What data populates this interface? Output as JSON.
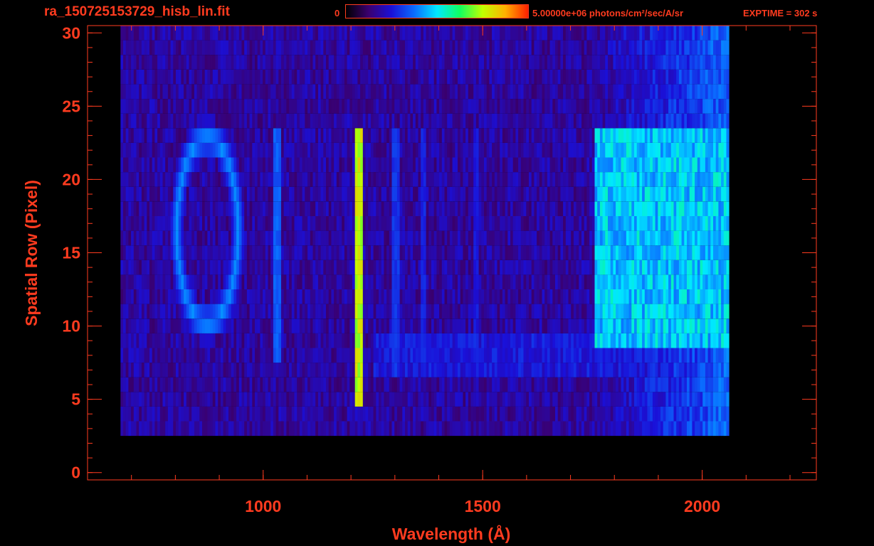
{
  "header": {
    "file_name": "ra_150725153729_hisb_lin.fit",
    "colorbar_min": "0",
    "colorbar_max": "5.00000e+06 photons/cm²/sec/A/sr",
    "exptime": "EXPTIME = 302 s"
  },
  "colors": {
    "axis": "#ff3b1f",
    "background": "#000000",
    "colormap": [
      "#000000",
      "#3a0070",
      "#1a10d8",
      "#0a6cff",
      "#00e8ff",
      "#10ff60",
      "#c0ff00",
      "#ffb000",
      "#ff2000"
    ]
  },
  "chart_data": {
    "type": "heatmap",
    "title": "",
    "xlabel": "Wavelength (Å)",
    "ylabel": "Spatial Row (Pixel)",
    "xlim": [
      600,
      2260
    ],
    "ylim": [
      -0.5,
      30.5
    ],
    "x_ticks": [
      1000,
      1500,
      2000
    ],
    "y_ticks": [
      0,
      5,
      10,
      15,
      20,
      25,
      30
    ],
    "x_minor_step": 100,
    "y_minor_step": 1,
    "colorbar_range": [
      0,
      5000000
    ],
    "colorbar_units": "photons/cm²/sec/A/sr",
    "signal_extent": {
      "x": [
        675,
        2060
      ],
      "y": [
        3,
        30
      ]
    },
    "features": [
      {
        "kind": "ring",
        "center": [
          870,
          16.5
        ],
        "radius_x": 70,
        "radius_y": 6.3,
        "value": 0.42
      },
      {
        "kind": "line",
        "x": 1030,
        "y": [
          8,
          23
        ],
        "width": 14,
        "value": 0.38
      },
      {
        "kind": "line",
        "x": 1215,
        "y": [
          5,
          23.5
        ],
        "width": 20,
        "value": 0.82
      },
      {
        "kind": "line",
        "x": 1300,
        "y": [
          7,
          23
        ],
        "width": 14,
        "value": 0.32
      },
      {
        "kind": "line",
        "x": 1360,
        "y": [
          7,
          23
        ],
        "width": 10,
        "value": 0.3
      },
      {
        "kind": "line",
        "x": 1480,
        "y": [
          8,
          23
        ],
        "width": 10,
        "value": 0.28
      },
      {
        "kind": "band",
        "x": [
          1750,
          2060
        ],
        "y": [
          9,
          23
        ],
        "value": 0.55
      },
      {
        "kind": "band",
        "x": [
          1250,
          2060
        ],
        "y": [
          7,
          9
        ],
        "value": 0.3
      }
    ]
  }
}
